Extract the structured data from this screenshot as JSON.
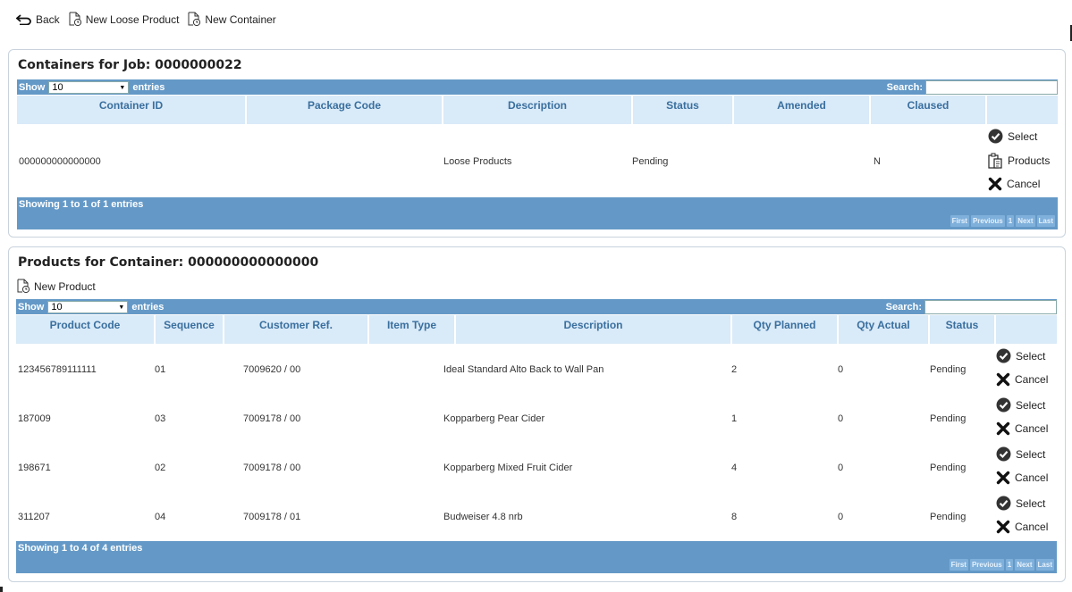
{
  "toolbar": {
    "back": "Back",
    "new_loose_product": "New Loose Product",
    "new_container": "New Container"
  },
  "containers": {
    "title": "Containers for Job: 0000000022",
    "show_label": "Show",
    "entries_value": "10",
    "entries_label": "entries",
    "search_label": "Search:",
    "columns": [
      "Container ID",
      "Package Code",
      "Description",
      "Status",
      "Amended",
      "Claused",
      ""
    ],
    "rows": [
      {
        "container_id": "000000000000000",
        "package_code": "",
        "description": "Loose Products",
        "status": "Pending",
        "amended": "",
        "claused": "N",
        "actions": [
          "Select",
          "Products",
          "Cancel"
        ]
      }
    ],
    "info": "Showing 1 to 1 of 1 entries",
    "pager": [
      "First",
      "Previous",
      "1",
      "Next",
      "Last"
    ]
  },
  "products": {
    "title": "Products for Container: 000000000000000",
    "new_product": "New Product",
    "show_label": "Show",
    "entries_value": "10",
    "entries_label": "entries",
    "search_label": "Search:",
    "columns": [
      "Product Code",
      "Sequence",
      "Customer Ref.",
      "Item Type",
      "Description",
      "Qty Planned",
      "Qty Actual",
      "Status",
      ""
    ],
    "rows": [
      {
        "product_code": "123456789111111",
        "sequence": "01",
        "customer_ref": "7009620 / 00",
        "item_type": "",
        "description": "Ideal Standard Alto Back to Wall Pan",
        "qty_planned": "2",
        "qty_actual": "0",
        "status": "Pending",
        "select": "Select",
        "cancel": "Cancel"
      },
      {
        "product_code": "187009",
        "sequence": "03",
        "customer_ref": "7009178 / 00",
        "item_type": "",
        "description": "Kopparberg Pear Cider",
        "qty_planned": "1",
        "qty_actual": "0",
        "status": "Pending",
        "select": "Select",
        "cancel": "Cancel"
      },
      {
        "product_code": "198671",
        "sequence": "02",
        "customer_ref": "7009178 / 00",
        "item_type": "",
        "description": "Kopparberg Mixed Fruit Cider",
        "qty_planned": "4",
        "qty_actual": "0",
        "status": "Pending",
        "select": "Select",
        "cancel": "Cancel"
      },
      {
        "product_code": "311207",
        "sequence": "04",
        "customer_ref": "7009178 / 01",
        "item_type": "",
        "description": "Budweiser 4.8 nrb",
        "qty_planned": "8",
        "qty_actual": "0",
        "status": "Pending",
        "select": "Select",
        "cancel": "Cancel"
      }
    ],
    "info": "Showing 1 to 4 of 4 entries",
    "pager": [
      "First",
      "Previous",
      "1",
      "Next",
      "Last"
    ]
  },
  "icons": {
    "back": "back-arrow-icon",
    "new_document": "new-document-icon",
    "select": "check-circle-icon",
    "products": "clipboard-icon",
    "cancel": "x-icon"
  },
  "colors": {
    "header_bar": "#6499c7",
    "column_header_bg": "#d9eaf8",
    "column_header_text": "#3a6f9e"
  }
}
